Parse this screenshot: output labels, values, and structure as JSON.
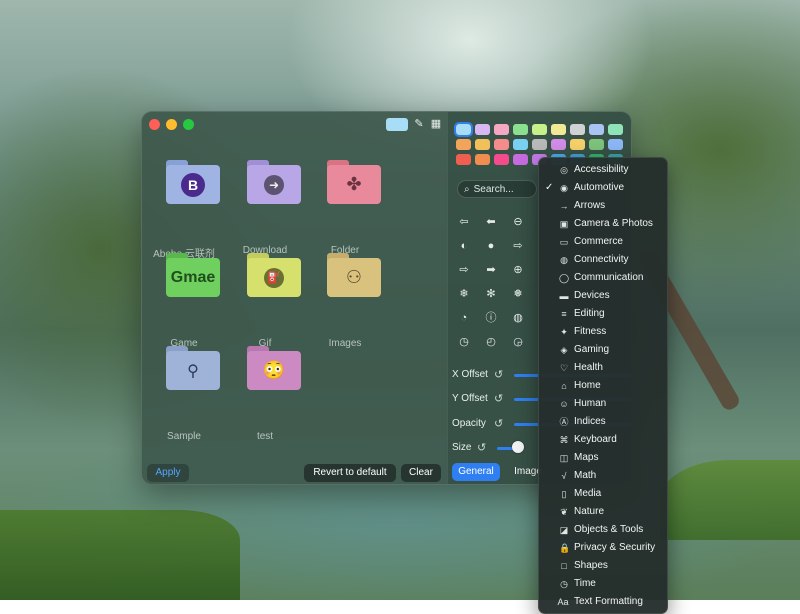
{
  "window": {
    "titlebar": {
      "traffic_lights": [
        "close",
        "minimize",
        "zoom"
      ],
      "swatch_color": "#a8ddf8",
      "icons": [
        "eyedropper-icon",
        "grid-icon"
      ]
    },
    "folders": [
      {
        "label": "Abobe 云联剂",
        "color": "#9fb4e3",
        "glyph": "B",
        "glyph_type": "badge-b"
      },
      {
        "label": "Download",
        "color": "#b9a6e6",
        "glyph": "➜",
        "glyph_type": "arrow-badge"
      },
      {
        "label": "Folder",
        "color": "#e88a9c",
        "glyph": "✤",
        "glyph_type": "clover-a"
      },
      {
        "label": "Game",
        "color": "#6fcf5f",
        "glyph": "Gmae",
        "glyph_type": "text"
      },
      {
        "label": "Gif",
        "color": "#d6e06d",
        "glyph": "⛽",
        "glyph_type": "fuel"
      },
      {
        "label": "Images",
        "color": "#d9c17e",
        "glyph": "⚇",
        "glyph_type": "outline"
      },
      {
        "label": "Sample",
        "color": "#9fb3d9",
        "glyph": "⚲",
        "glyph_type": "oil"
      },
      {
        "label": "test",
        "color": "#cc8ac2",
        "glyph": "😳",
        "glyph_type": "emoji"
      }
    ],
    "buttons": {
      "apply": "Apply",
      "revert": "Revert to default",
      "clear": "Clear"
    },
    "palette": [
      [
        "#a8ddf8",
        "#d7b8f2",
        "#f4a8c4",
        "#8be08f",
        "#c7ef8a",
        "#f1ea95",
        "#cfd2d2",
        "#a8c4f2",
        "#8fe3b8"
      ],
      [
        "#f2a45a",
        "#f2c05a",
        "#f58c8c",
        "#7ad0f0",
        "#b9b9b9",
        "#d28be6",
        "#f5d06a",
        "#7cc37c",
        "#8cb6f5"
      ],
      [
        "#f05e4f",
        "#f08e4f",
        "#f54a8c",
        "#c76be0",
        "#c47be8",
        "#4aa9f0",
        "#3fa0d8",
        "#2fb36a",
        "#36a3a8"
      ]
    ],
    "search": {
      "placeholder": "Search..."
    },
    "sliders": [
      {
        "label": "X Offset",
        "value": 0.0
      },
      {
        "label": "Y Offset",
        "value": 0.0
      },
      {
        "label": "Opacity",
        "value": 1.0
      },
      {
        "label": "Size",
        "value": 0.15
      }
    ],
    "tabs": [
      {
        "label": "General",
        "selected": true
      },
      {
        "label": "Image",
        "selected": false
      }
    ]
  },
  "menu": {
    "items": [
      {
        "label": "Accessibility",
        "icon": "◎",
        "checked": false
      },
      {
        "label": "Automotive",
        "icon": "◉",
        "checked": true
      },
      {
        "label": "Arrows",
        "icon": "→",
        "checked": false
      },
      {
        "label": "Camera & Photos",
        "icon": "▣",
        "checked": false
      },
      {
        "label": "Commerce",
        "icon": "▭",
        "checked": false
      },
      {
        "label": "Connectivity",
        "icon": "◍",
        "checked": false
      },
      {
        "label": "Communication",
        "icon": "◯",
        "checked": false
      },
      {
        "label": "Devices",
        "icon": "▬",
        "checked": false
      },
      {
        "label": "Editing",
        "icon": "≡",
        "checked": false
      },
      {
        "label": "Fitness",
        "icon": "✦",
        "checked": false
      },
      {
        "label": "Gaming",
        "icon": "◈",
        "checked": false
      },
      {
        "label": "Health",
        "icon": "♡",
        "checked": false
      },
      {
        "label": "Home",
        "icon": "⌂",
        "checked": false
      },
      {
        "label": "Human",
        "icon": "☺",
        "checked": false
      },
      {
        "label": "Indices",
        "icon": "Ⓐ",
        "checked": false
      },
      {
        "label": "Keyboard",
        "icon": "⌘",
        "checked": false
      },
      {
        "label": "Maps",
        "icon": "◫",
        "checked": false
      },
      {
        "label": "Math",
        "icon": "√",
        "checked": false
      },
      {
        "label": "Media",
        "icon": "▯",
        "checked": false
      },
      {
        "label": "Nature",
        "icon": "❦",
        "checked": false
      },
      {
        "label": "Objects & Tools",
        "icon": "◪",
        "checked": false
      },
      {
        "label": "Privacy & Security",
        "icon": "🔒",
        "checked": false
      },
      {
        "label": "Shapes",
        "icon": "□",
        "checked": false
      },
      {
        "label": "Time",
        "icon": "◷",
        "checked": false
      },
      {
        "label": "Text Formatting",
        "icon": "Aa",
        "checked": false
      }
    ]
  }
}
